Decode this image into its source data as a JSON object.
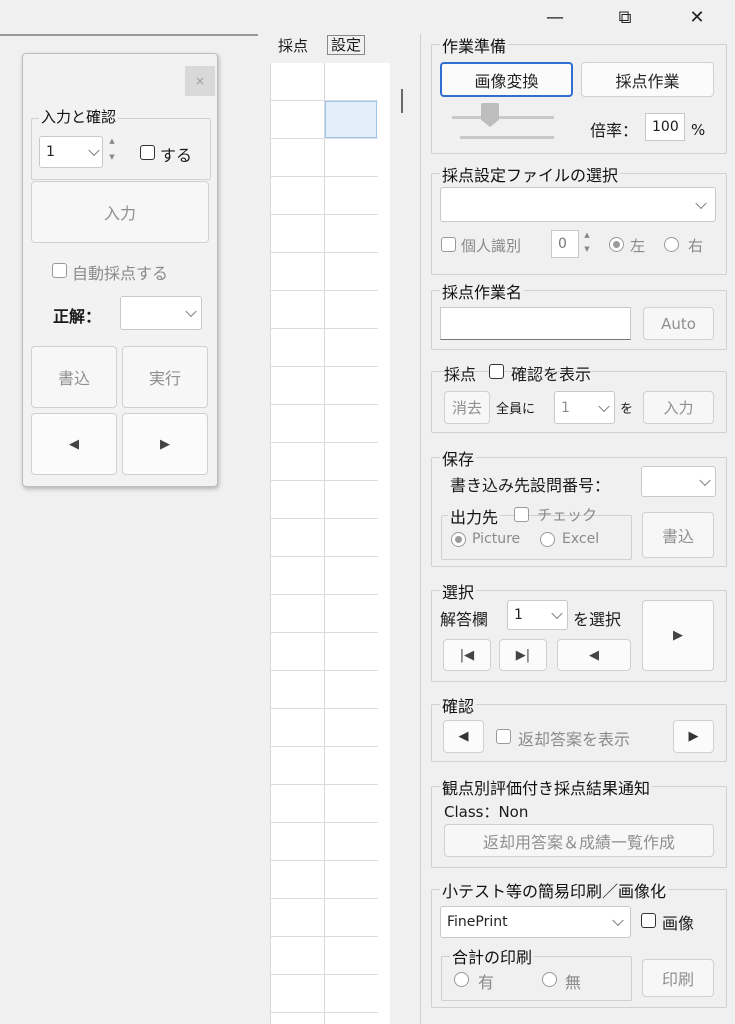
{
  "window": {
    "minimize": "—",
    "restore": "⧉",
    "close": "✕"
  },
  "palette": {
    "close": "×",
    "group_title": "入力と確認",
    "number_value": "1",
    "do_label": "する",
    "input_button": "入力",
    "auto_grade_label": "自動採点する",
    "answer_label": "正解：",
    "answer_value": "",
    "write_button": "書込",
    "run_button": "実行",
    "prev": "◀",
    "next": "▶"
  },
  "grid": {
    "header_score": "採点",
    "header_settings": "設定"
  },
  "prep": {
    "title": "作業準備",
    "convert_button": "画像変換",
    "grade_button": "採点作業",
    "zoom_label": "倍率：",
    "zoom_value": "100",
    "zoom_unit": "%"
  },
  "settings_file": {
    "title": "採点設定ファイルの選択",
    "selected": "",
    "personal_id_label": "個人識別",
    "personal_id_value": "0",
    "left_label": "左",
    "right_label": "右"
  },
  "task_name": {
    "title": "採点作業名",
    "value": "",
    "auto_button": "Auto"
  },
  "grading": {
    "title": "採点",
    "show_confirm_label": "確認を表示",
    "erase_button": "消去",
    "all_label": "全員に",
    "value": "1",
    "wo_label": "を",
    "input_button": "入力"
  },
  "save": {
    "title": "保存",
    "dest_label": "書き込み先設問番号：",
    "dest_value": "",
    "output_label": "出力先",
    "check_label": "チェック",
    "picture_label": "Picture",
    "excel_label": "Excel",
    "write_button": "書込"
  },
  "select": {
    "title": "選択",
    "answer_col_label": "解答欄",
    "answer_col_value": "1",
    "select_label": "を選択",
    "first": "|◀",
    "last": "▶|",
    "prev": "◀",
    "next": "▶"
  },
  "confirm": {
    "title": "確認",
    "prev": "◀",
    "show_return_label": "返却答案を表示",
    "next": "▶"
  },
  "notify": {
    "title": "観点別評価付き採点結果通知",
    "class_text": "Class：Non",
    "make_button": "返却用答案＆成績一覧作成"
  },
  "print": {
    "title": "小テスト等の簡易印刷／画像化",
    "printer": "FinePrint",
    "image_label": "画像",
    "total_title": "合計の印刷",
    "yes_label": "有",
    "no_label": "無",
    "print_button": "印刷"
  },
  "colors": {
    "accent": "#2f6fd1",
    "selected_cell": "#e3eefb"
  }
}
